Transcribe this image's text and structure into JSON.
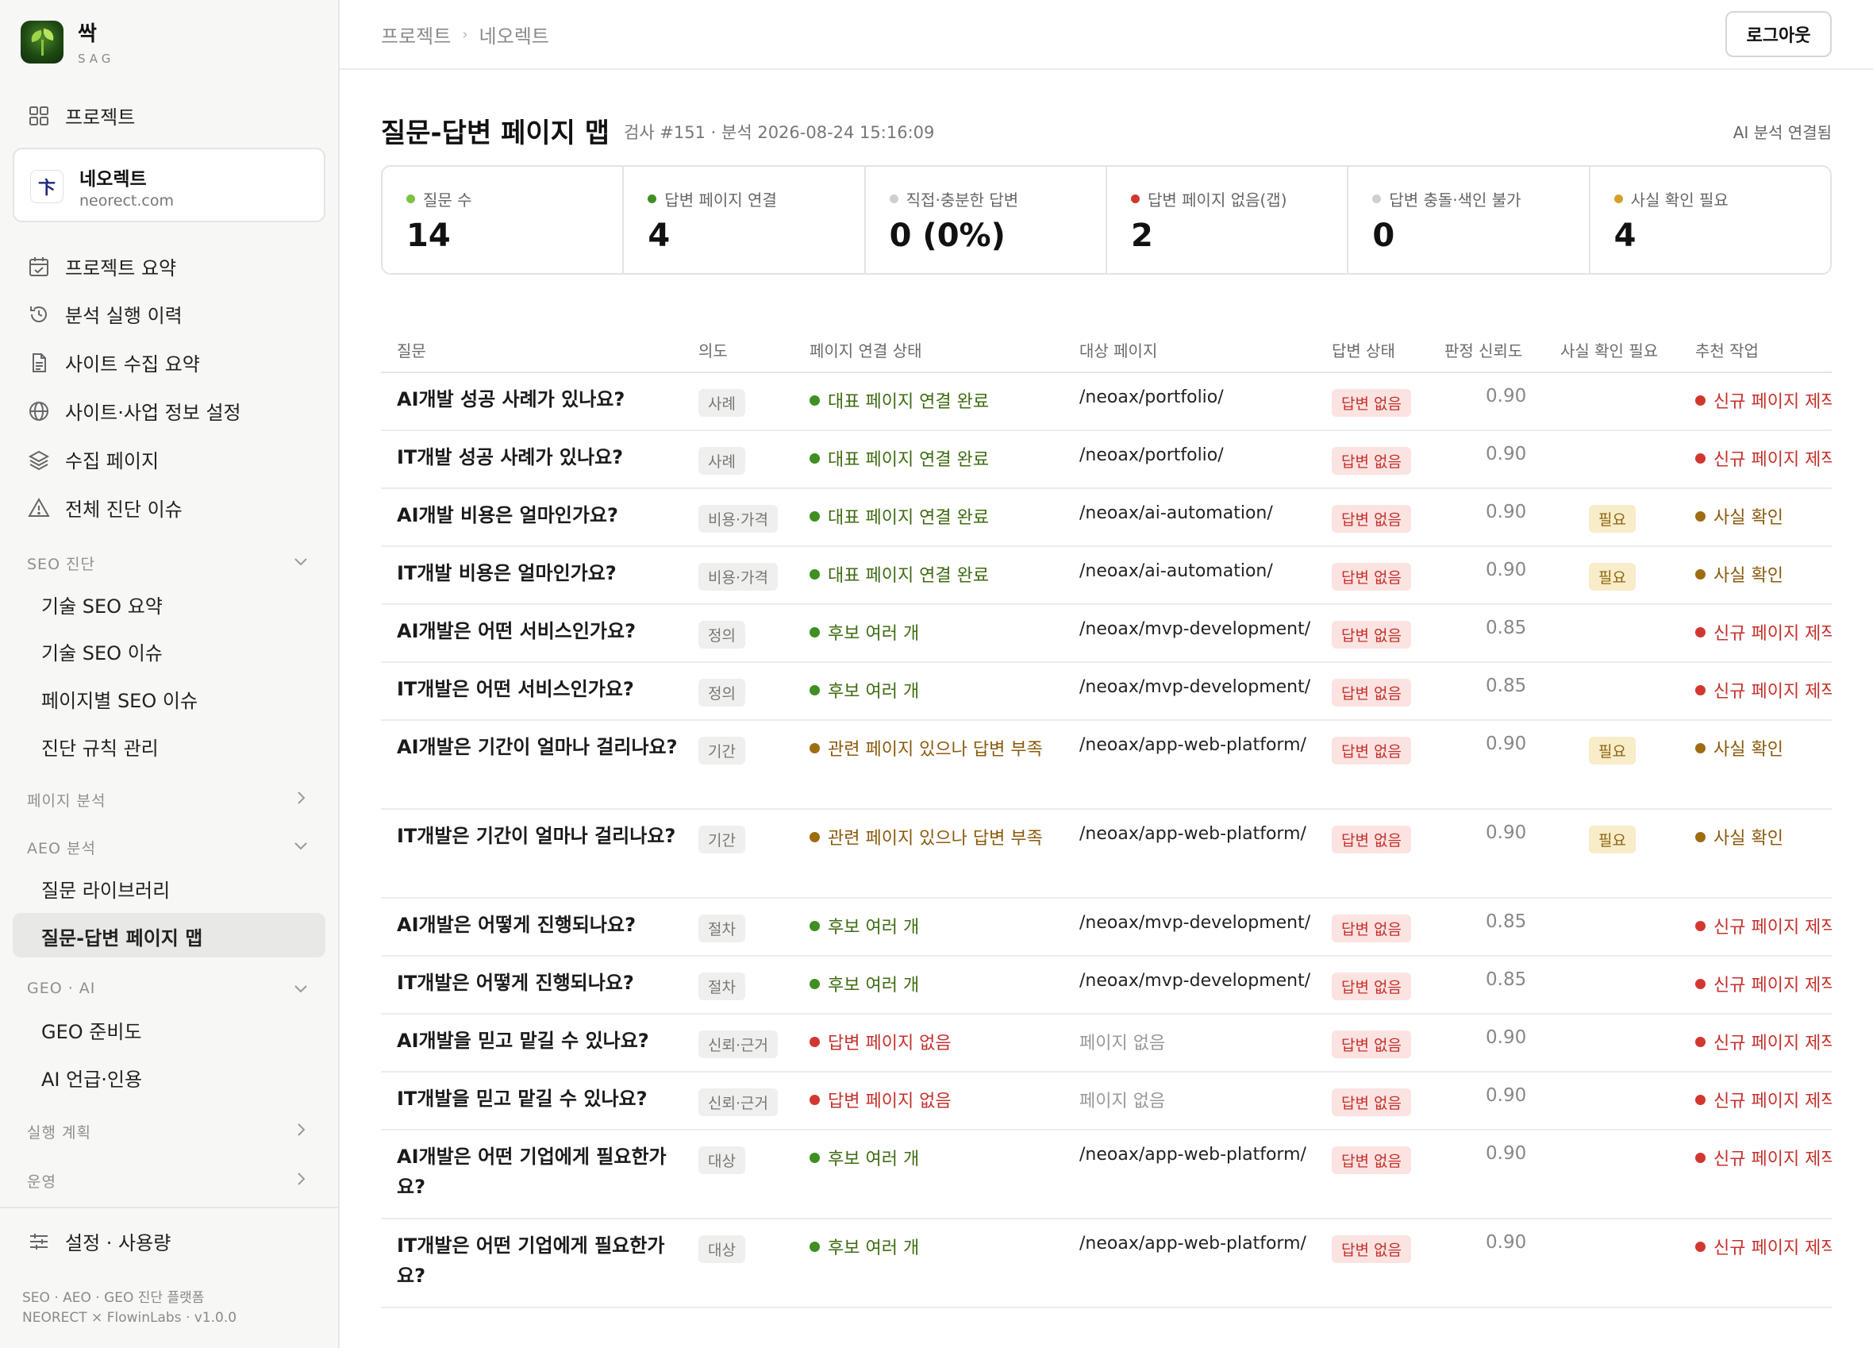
{
  "brand": {
    "name": "싹",
    "sub": "SAG"
  },
  "sidebar": {
    "projects_label": "프로젝트",
    "project": {
      "icon_text": "卞",
      "name": "네오렉트",
      "domain": "neorect.com"
    },
    "items": [
      "프로젝트 요약",
      "분석 실행 이력",
      "사이트 수집 요약",
      "사이트·사업 정보 설정",
      "수집 페이지",
      "전체 진단 이슈"
    ],
    "sections": [
      {
        "title": "SEO 진단",
        "expanded": true,
        "items": [
          "기술 SEO 요약",
          "기술 SEO 이슈",
          "페이지별 SEO 이슈",
          "진단 규칙 관리"
        ]
      },
      {
        "title": "페이지 분석",
        "expanded": false
      },
      {
        "title": "AEO 분석",
        "expanded": true,
        "items": [
          "질문 라이브러리",
          "질문-답변 페이지 맵"
        ],
        "active": "질문-답변 페이지 맵"
      },
      {
        "title": "GEO · AI",
        "expanded": true,
        "items": [
          "GEO 준비도",
          "AI 언급·인용"
        ]
      },
      {
        "title": "실행 계획",
        "expanded": false
      },
      {
        "title": "운영",
        "expanded": false
      }
    ],
    "settings_label": "설정 · 사용량",
    "footer_line1": "SEO · AEO · GEO 진단 플랫폼",
    "footer_line2": "NEORECT × FlowinLabs · v1.0.0"
  },
  "topbar": {
    "breadcrumb": [
      "프로젝트",
      "네오렉트"
    ],
    "logout_label": "로그아웃"
  },
  "page": {
    "title": "질문-답변 페이지 맵",
    "meta": "검사 #151 · 분석 2026-08-24 15:16:09",
    "ai_status": "AI 분석 연결됨"
  },
  "stats": [
    {
      "label": "질문 수",
      "value": "14",
      "color": "#7dc142"
    },
    {
      "label": "답변 페이지 연결",
      "value": "4",
      "color": "#3f8f22"
    },
    {
      "label": "직접·충분한 답변",
      "value": "0 (0%)",
      "color": "#cfcfcf"
    },
    {
      "label": "답변 페이지 없음(갭)",
      "value": "2",
      "color": "#d2372f"
    },
    {
      "label": "답변 충돌·색인 불가",
      "value": "0",
      "color": "#cfcfcf"
    },
    {
      "label": "사실 확인 필요",
      "value": "4",
      "color": "#d4a12a"
    }
  ],
  "table": {
    "columns": [
      "질문",
      "의도",
      "페이지 연결 상태",
      "대상 페이지",
      "답변 상태",
      "판정 신뢰도",
      "사실 확인 필요",
      "추천 작업"
    ],
    "rows": [
      {
        "question": "AI개발 성공 사례가 있나요?",
        "intent": "사례",
        "status": "대표 페이지 연결 완료",
        "status_tone": "green",
        "target": "/neoax/portfolio/",
        "answer": "답변 없음",
        "confidence": "0.90",
        "fact": "",
        "action": "신규 페이지 제작",
        "action_tone": "red"
      },
      {
        "question": "IT개발 성공 사례가 있나요?",
        "intent": "사례",
        "status": "대표 페이지 연결 완료",
        "status_tone": "green",
        "target": "/neoax/portfolio/",
        "answer": "답변 없음",
        "confidence": "0.90",
        "fact": "",
        "action": "신규 페이지 제작",
        "action_tone": "red"
      },
      {
        "question": "AI개발 비용은 얼마인가요?",
        "intent": "비용·가격",
        "status": "대표 페이지 연결 완료",
        "status_tone": "green",
        "target": "/neoax/ai-automation/",
        "answer": "답변 없음",
        "confidence": "0.90",
        "fact": "필요",
        "action": "사실 확인",
        "action_tone": "amber"
      },
      {
        "question": "IT개발 비용은 얼마인가요?",
        "intent": "비용·가격",
        "status": "대표 페이지 연결 완료",
        "status_tone": "green",
        "target": "/neoax/ai-automation/",
        "answer": "답변 없음",
        "confidence": "0.90",
        "fact": "필요",
        "action": "사실 확인",
        "action_tone": "amber"
      },
      {
        "question": "AI개발은 어떤 서비스인가요?",
        "intent": "정의",
        "status": "후보 여러 개",
        "status_tone": "green",
        "target": "/neoax/mvp-development/",
        "answer": "답변 없음",
        "confidence": "0.85",
        "fact": "",
        "action": "신규 페이지 제작",
        "action_tone": "red"
      },
      {
        "question": "IT개발은 어떤 서비스인가요?",
        "intent": "정의",
        "status": "후보 여러 개",
        "status_tone": "green",
        "target": "/neoax/mvp-development/",
        "answer": "답변 없음",
        "confidence": "0.85",
        "fact": "",
        "action": "신규 페이지 제작",
        "action_tone": "red"
      },
      {
        "question": "AI개발은 기간이 얼마나 걸리나요?",
        "intent": "기간",
        "status": "관련 페이지 있으나 답변 부족",
        "status_tone": "amber",
        "target": "/neoax/app-web-platform/",
        "answer": "답변 없음",
        "confidence": "0.90",
        "fact": "필요",
        "action": "사실 확인",
        "action_tone": "amber",
        "tall": true
      },
      {
        "question": "IT개발은 기간이 얼마나 걸리나요?",
        "intent": "기간",
        "status": "관련 페이지 있으나 답변 부족",
        "status_tone": "amber",
        "target": "/neoax/app-web-platform/",
        "answer": "답변 없음",
        "confidence": "0.90",
        "fact": "필요",
        "action": "사실 확인",
        "action_tone": "amber",
        "tall": true
      },
      {
        "question": "AI개발은 어떻게 진행되나요?",
        "intent": "절차",
        "status": "후보 여러 개",
        "status_tone": "green",
        "target": "/neoax/mvp-development/",
        "answer": "답변 없음",
        "confidence": "0.85",
        "fact": "",
        "action": "신규 페이지 제작",
        "action_tone": "red"
      },
      {
        "question": "IT개발은 어떻게 진행되나요?",
        "intent": "절차",
        "status": "후보 여러 개",
        "status_tone": "green",
        "target": "/neoax/mvp-development/",
        "answer": "답변 없음",
        "confidence": "0.85",
        "fact": "",
        "action": "신규 페이지 제작",
        "action_tone": "red"
      },
      {
        "question": "AI개발을 믿고 맡길 수 있나요?",
        "intent": "신뢰·근거",
        "status": "답변 페이지 없음",
        "status_tone": "red",
        "target": "페이지 없음",
        "target_none": true,
        "answer": "답변 없음",
        "confidence": "0.90",
        "fact": "",
        "action": "신규 페이지 제작",
        "action_tone": "red"
      },
      {
        "question": "IT개발을 믿고 맡길 수 있나요?",
        "intent": "신뢰·근거",
        "status": "답변 페이지 없음",
        "status_tone": "red",
        "target": "페이지 없음",
        "target_none": true,
        "answer": "답변 없음",
        "confidence": "0.90",
        "fact": "",
        "action": "신규 페이지 제작",
        "action_tone": "red"
      },
      {
        "question": "AI개발은 어떤 기업에게 필요한가요?",
        "intent": "대상",
        "status": "후보 여러 개",
        "status_tone": "green",
        "target": "/neoax/app-web-platform/",
        "answer": "답변 없음",
        "confidence": "0.90",
        "fact": "",
        "action": "신규 페이지 제작",
        "action_tone": "red",
        "tall": true
      },
      {
        "question": "IT개발은 어떤 기업에게 필요한가요?",
        "intent": "대상",
        "status": "후보 여러 개",
        "status_tone": "green",
        "target": "/neoax/app-web-platform/",
        "answer": "답변 없음",
        "confidence": "0.90",
        "fact": "",
        "action": "신규 페이지 제작",
        "action_tone": "red",
        "tall": true
      }
    ]
  }
}
